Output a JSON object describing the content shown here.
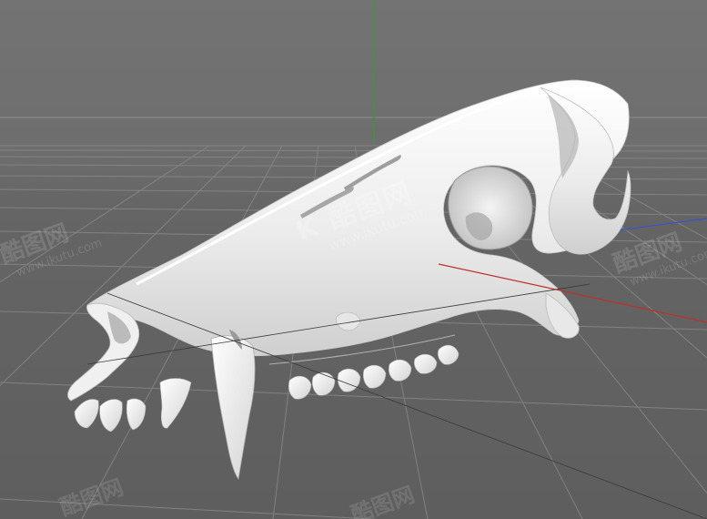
{
  "viewport": {
    "background_top": "#737373",
    "background_bottom": "#5e5e5e",
    "grid_color": "#8a8a8a",
    "axis_x_color": "#c0302a",
    "axis_y_color": "#2fa02f",
    "axis_z_color": "#3a55c8",
    "model_color": "#f2f2f2"
  },
  "watermark": {
    "brand": "酷图网",
    "url": "www.ikutu.com",
    "logo_glyph": "K"
  },
  "model": {
    "subject": "animal-skull",
    "icon": "skull-icon"
  }
}
